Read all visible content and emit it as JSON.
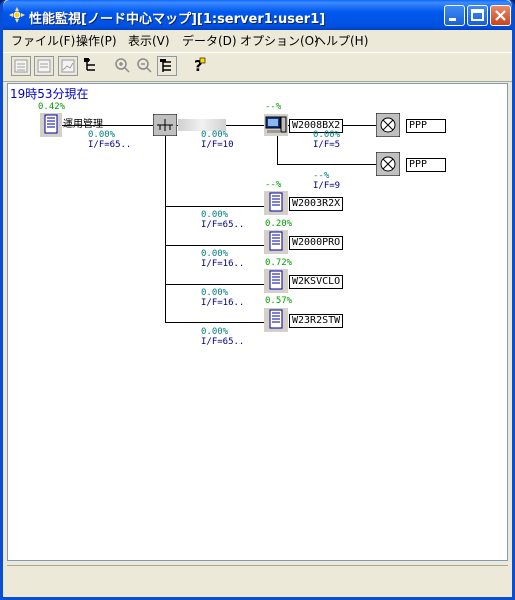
{
  "window": {
    "title": "性能監視[ノード中心マップ][1:server1:user1]"
  },
  "menu": {
    "file": "ファイル(F)",
    "operation": "操作(P)",
    "view": "表示(V)",
    "data": "データ(D)",
    "options": "オプション(O)",
    "help": "ヘルプ(H)"
  },
  "toolbar": {
    "icons": [
      "doc-icon",
      "doc-icon",
      "chart-icon",
      "tree-icon",
      "zoom-in-icon",
      "zoom-out-icon",
      "tree-icon",
      "help-icon"
    ]
  },
  "map": {
    "timestamp": "19時53分現在",
    "center": {
      "label": "運用管理",
      "pct": "0.42%"
    },
    "link_center": {
      "pct": "0.00%",
      "iface": "I/F=65.."
    },
    "link_switch": {
      "pct": "0.00%",
      "iface": "I/F=10"
    },
    "server": {
      "label": "W2008BX2",
      "pct": "--%"
    },
    "ppp1": {
      "label": "PPP",
      "pct": "0.00%",
      "iface": "I/F=5"
    },
    "ppp2": {
      "label": "PPP",
      "pct": "--%",
      "iface": "I/F=9"
    },
    "nodes": [
      {
        "label": "W2003R2X",
        "pct": "--%",
        "link_pct": "0.00%",
        "link_iface": "I/F=65.."
      },
      {
        "label": "W2000PRO",
        "pct": "0.20%",
        "link_pct": "0.00%",
        "link_iface": "I/F=16.."
      },
      {
        "label": "W2KSVCLO",
        "pct": "0.72%",
        "link_pct": "0.00%",
        "link_iface": "I/F=16.."
      },
      {
        "label": "W23R2STW",
        "pct": "0.57%",
        "link_pct": "0.00%",
        "link_iface": "I/F=65.."
      }
    ]
  }
}
